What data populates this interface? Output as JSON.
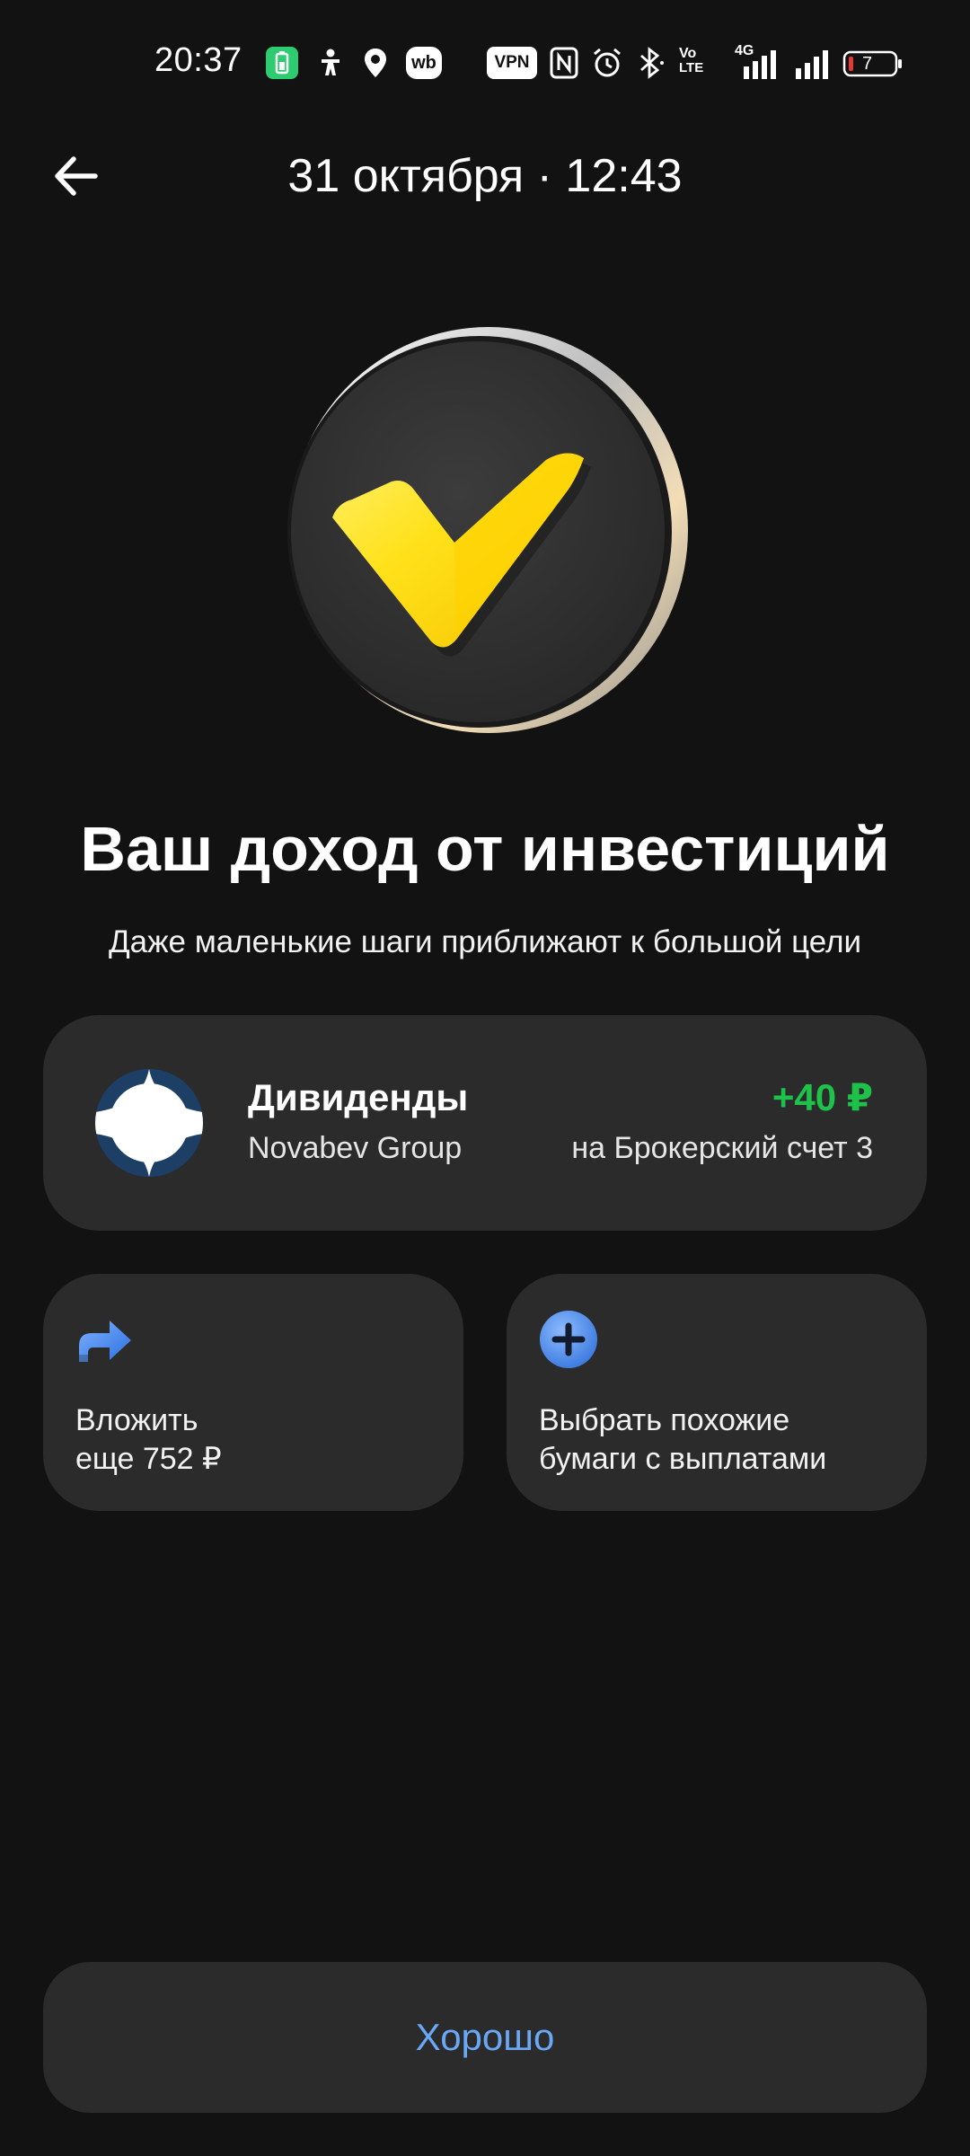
{
  "status_bar": {
    "time": "20:37",
    "vpn_label": "VPN",
    "wb_label": "wb",
    "volte_label_top": "Vo",
    "volte_label_bottom": "LTE",
    "network_label": "4G",
    "battery_level": "7",
    "icons": [
      "battery-saver-icon",
      "accessibility-icon",
      "location-icon",
      "wb-app-icon",
      "vpn-icon",
      "nfc-icon",
      "alarm-icon",
      "bluetooth-icon",
      "volte-icon",
      "signal-4g-icon",
      "signal-icon",
      "battery-icon"
    ]
  },
  "header": {
    "title": "31 октября · 12:43",
    "back_icon": "arrow-left-icon"
  },
  "hero": {
    "icon": "checkmark-coin-icon",
    "colors": {
      "coin": "#333333",
      "check": "#ffdd2d",
      "rim": "#d9d9d9"
    }
  },
  "main": {
    "headline": "Ваш доход от инвестиций",
    "subline": "Даже маленькие шаги приближают к большой цели"
  },
  "dividend": {
    "title": "Дивиденды",
    "company": "Novabev Group",
    "amount": "+40 ₽",
    "account": "на Брокерский счет 3",
    "logo_icon": "novabev-logo-icon",
    "amount_color": "#1ec24a"
  },
  "actions": [
    {
      "icon": "forward-arrow-icon",
      "line1": "Вложить",
      "line2": "еще 752 ₽"
    },
    {
      "icon": "plus-circle-icon",
      "line1": "Выбрать похожие",
      "line2": "бумаги с выплатами"
    }
  ],
  "footer": {
    "ok_label": "Хорошо",
    "accent_color": "#6aa8f5"
  }
}
